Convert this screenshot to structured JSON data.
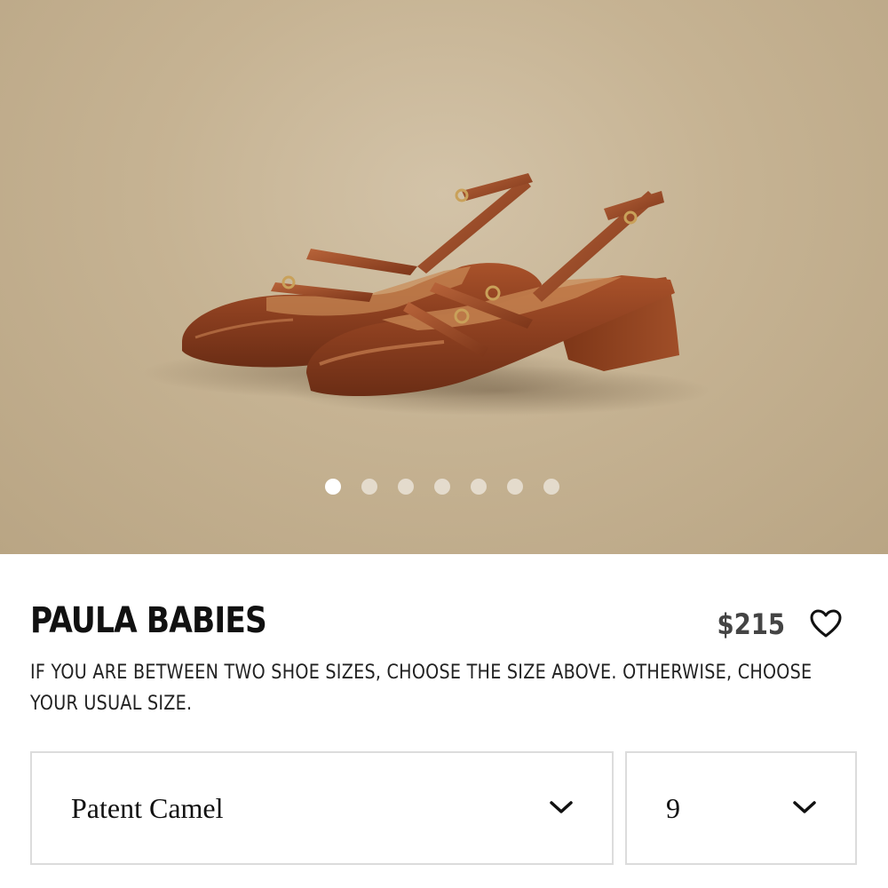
{
  "product": {
    "name": "PAULA BABIES",
    "price": "$215",
    "size_note": "IF YOU ARE BETWEEN TWO SHOE SIZES, CHOOSE THE SIZE ABOVE. OTHERWISE, CHOOSE YOUR USUAL SIZE."
  },
  "gallery": {
    "image_count": 7,
    "active_index": 0
  },
  "selectors": {
    "color_value": "Patent Camel",
    "size_value": "9"
  },
  "icons": {
    "favorite": "heart-outline-icon",
    "dropdown": "chevron-down-icon"
  },
  "colors": {
    "background_image": "#c6b393",
    "shoe_leather": "#8a3e1f",
    "price_text": "#444444",
    "border": "#dcdcdc"
  }
}
